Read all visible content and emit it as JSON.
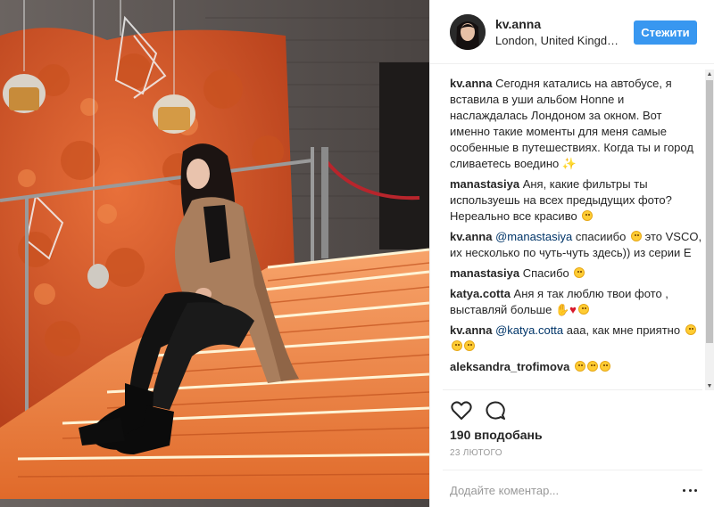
{
  "post": {
    "photo_icon": "photo-woman-on-orange-stairs"
  },
  "header": {
    "username": "kv.anna",
    "location": "London, United Kingdom",
    "follow_label": "Стежити",
    "avatar_icon": "avatar-icon"
  },
  "comments": [
    {
      "author": "kv.anna",
      "text": "Сегодня катались на автобусе, я вставила в уши альбом Honne и наслаждалась Лондоном за окном. Вот именно такие моменты для меня самые особенные в путешествиях. Когда ты и город сливаетесь воедино",
      "emoji": "✨"
    },
    {
      "author": "manastasiya",
      "text": "Аня, какие фильтры ты используешь на всех предыдущих фото? Нереально все красиво"
    },
    {
      "author": "kv.anna",
      "mention": "@manastasiya",
      "text_before_emoji": "спасиибо",
      "text": "это VSCO, их несколько по чуть-чуть здесь)) из серии E"
    },
    {
      "author": "manastasiya",
      "text": "Спасибо"
    },
    {
      "author": "katya.cotta",
      "text": "Аня я так люблю твои фото , выставляй больше"
    },
    {
      "author": "kv.anna",
      "mention": "@katya.cotta",
      "text": "ааа, как мне приятно"
    },
    {
      "author": "aleksandra_trofimova",
      "text": ""
    }
  ],
  "actions": {
    "like_icon": "heart-icon",
    "comment_icon": "comment-icon"
  },
  "likes_label": "190 вподобань",
  "date": "23 ЛЮТОГО",
  "add_comment_placeholder": "Додайте коментар...",
  "more_icon": "more-options-icon",
  "colors": {
    "follow_button": "#3897f0",
    "mention": "#003569",
    "divider": "#efefef",
    "muted": "#999999"
  }
}
